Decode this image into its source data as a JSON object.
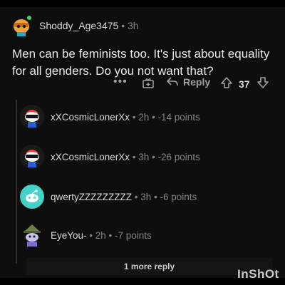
{
  "comment": {
    "username": "Shoddy_Age3475",
    "meta": " • 3h",
    "body": "Men can be feminists too. It's just about equality for all genders. Do you not want that?",
    "actions": {
      "more_label": "•••",
      "reply_label": "Reply",
      "score": "37"
    }
  },
  "replies": [
    {
      "username": "xXCosmicLonerXx",
      "meta": " • 2h • -14 points"
    },
    {
      "username": "xXCosmicLonerXx",
      "meta": " • 3h • -26 points"
    },
    {
      "username": "qwertyZZZZZZZZZ",
      "meta": " • 3h • -6 points"
    },
    {
      "username": "EyeYou-",
      "meta": " • 2h • -7 points"
    }
  ],
  "more_replies_label": "1 more reply",
  "watermark": "InShOt",
  "colors": {
    "background": "#0e0e0f",
    "text": "#d7dadc",
    "muted": "#818384",
    "online_dot": "#46d160"
  }
}
